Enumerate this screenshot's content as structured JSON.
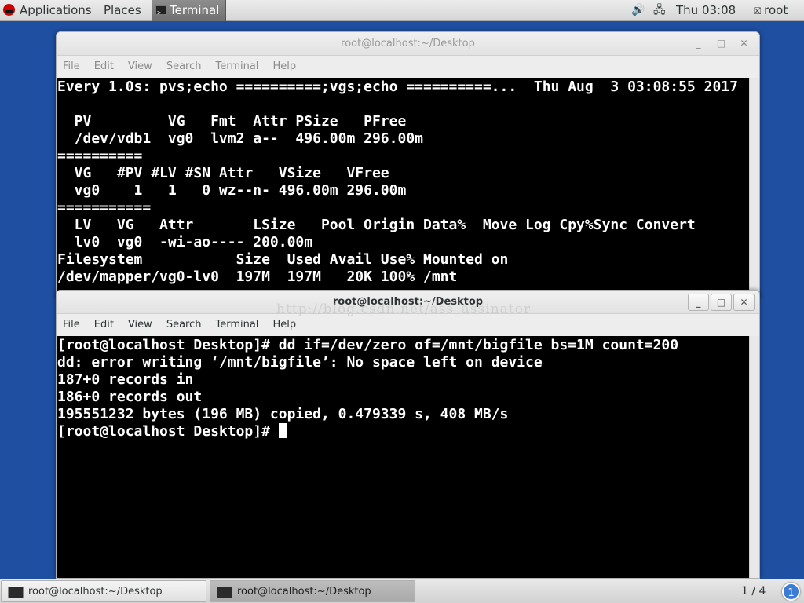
{
  "top_panel": {
    "applications": "Applications",
    "places": "Places",
    "terminal": "Terminal",
    "clock": "Thu 03:08",
    "user": "root"
  },
  "window_back": {
    "title": "root@localhost:~/Desktop",
    "menu": [
      "File",
      "Edit",
      "View",
      "Search",
      "Terminal",
      "Help"
    ],
    "lines": [
      "Every 1.0s: pvs;echo ==========;vgs;echo ==========...  Thu Aug  3 03:08:55 2017",
      "",
      "  PV         VG   Fmt  Attr PSize   PFree",
      "  /dev/vdb1  vg0  lvm2 a--  496.00m 296.00m",
      "==========",
      "  VG   #PV #LV #SN Attr   VSize   VFree",
      "  vg0    1   1   0 wz--n- 496.00m 296.00m",
      "===========",
      "  LV   VG   Attr       LSize   Pool Origin Data%  Move Log Cpy%Sync Convert",
      "  lv0  vg0  -wi-ao---- 200.00m",
      "Filesystem           Size  Used Avail Use% Mounted on",
      "/dev/mapper/vg0-lv0  197M  197M   20K 100% /mnt"
    ]
  },
  "window_front": {
    "title": "root@localhost:~/Desktop",
    "menu": [
      "File",
      "Edit",
      "View",
      "Search",
      "Terminal",
      "Help"
    ],
    "lines": [
      "[root@localhost Desktop]# dd if=/dev/zero of=/mnt/bigfile bs=1M count=200",
      "dd: error writing ‘/mnt/bigfile’: No space left on device",
      "187+0 records in",
      "186+0 records out",
      "195551232 bytes (196 MB) copied, 0.479339 s, 408 MB/s"
    ],
    "prompt": "[root@localhost Desktop]# "
  },
  "watermark": "http://blog.csdn.net/ass_assinator",
  "bottom_panel": {
    "task1": "root@localhost:~/Desktop",
    "task2": "root@localhost:~/Desktop",
    "workspace": "1 / 4",
    "badge": "1"
  }
}
